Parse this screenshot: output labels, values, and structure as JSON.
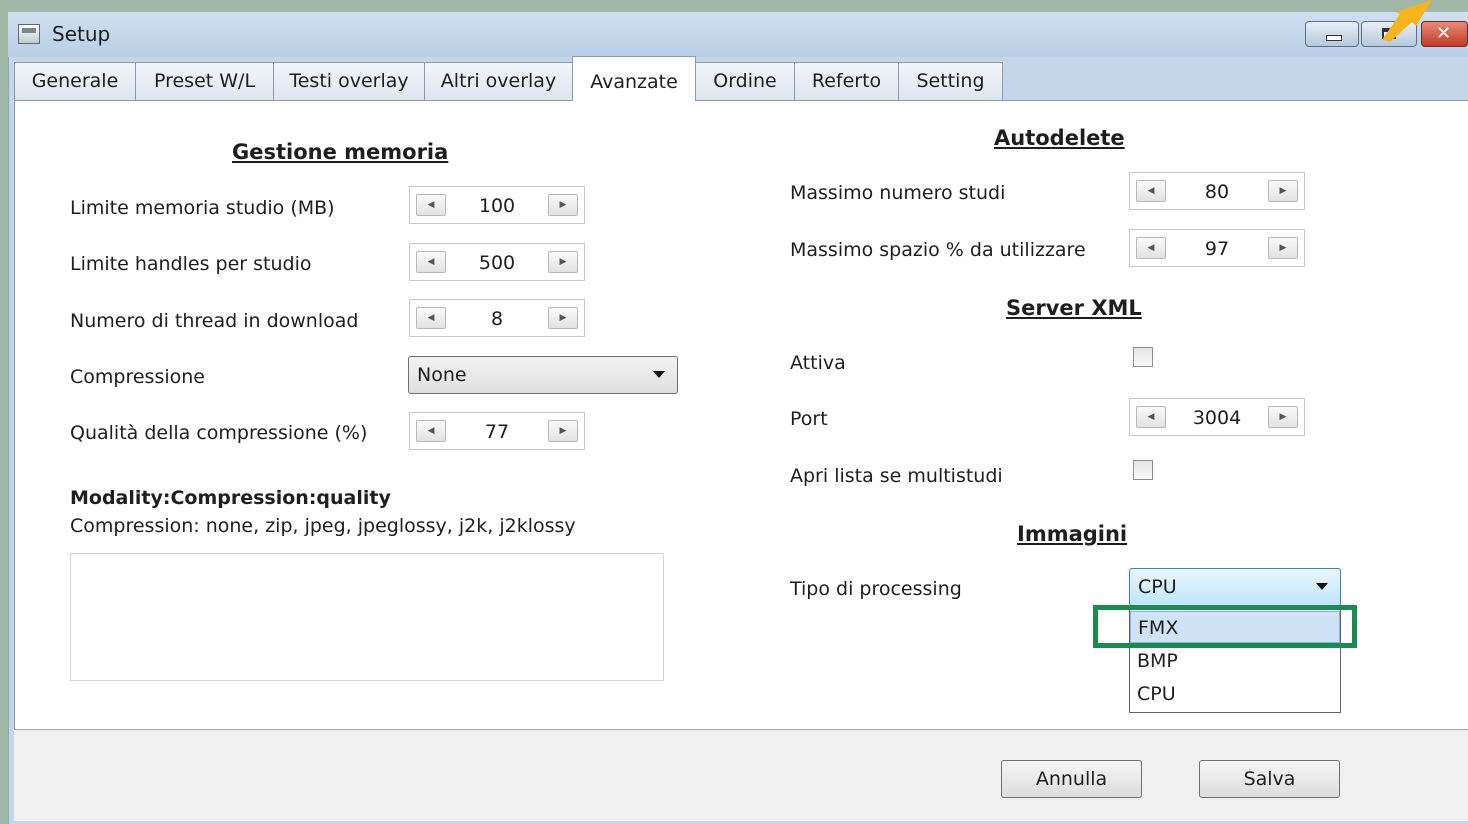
{
  "window": {
    "title": "Setup"
  },
  "tabs": [
    "Generale",
    "Preset W/L",
    "Testi overlay",
    "Altri overlay",
    "Avanzate",
    "Ordine",
    "Referto",
    "Setting"
  ],
  "active_tab": "Avanzate",
  "memory": {
    "heading": "Gestione memoria",
    "rows": [
      {
        "label": "Limite memoria studio (MB)",
        "value": "100"
      },
      {
        "label": "Limite handles per studio",
        "value": "500"
      },
      {
        "label": "Numero di thread in download",
        "value": "8"
      }
    ],
    "compression_label": "Compressione",
    "compression_value": "None",
    "quality_label": "Qualità della compressione (%)",
    "quality_value": "77",
    "modality_title": "Modality:Compression:quality",
    "modality_help": "Compression: none, zip,  jpeg, jpeglossy, j2k, j2klossy",
    "modality_text": ""
  },
  "autodelete": {
    "heading": "Autodelete",
    "rows": [
      {
        "label": "Massimo numero studi",
        "value": "80"
      },
      {
        "label": "Massimo spazio % da utilizzare",
        "value": "97"
      }
    ]
  },
  "server_xml": {
    "heading": "Server XML",
    "attiva_label": "Attiva",
    "attiva_checked": false,
    "port_label": "Port",
    "port_value": "3004",
    "apri_label": "Apri lista se multistudi",
    "apri_checked": false
  },
  "immagini": {
    "heading": "Immagini",
    "processing_label": "Tipo di processing",
    "processing_value": "CPU",
    "options": [
      "FMX",
      "BMP",
      "CPU"
    ],
    "highlighted_option": "FMX"
  },
  "footer": {
    "cancel": "Annulla",
    "save": "Salva"
  },
  "colors": {
    "highlight_box": "#1d8a4f",
    "pointer_arrow": "#f6b51e",
    "close_button": "#c13a28"
  }
}
